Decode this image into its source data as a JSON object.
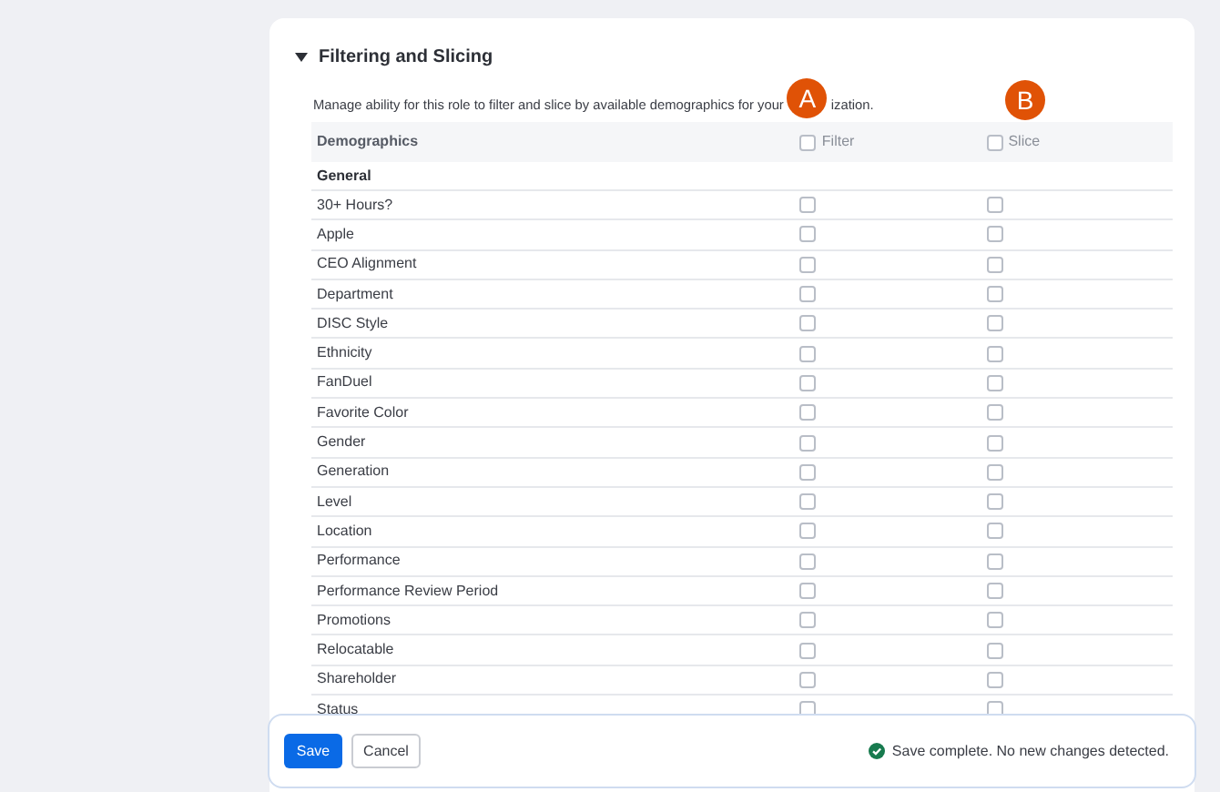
{
  "section": {
    "title": "Filtering and Slicing",
    "expanded": true,
    "description_start": "Manage ability for this role to filter and slice by available demographics for your",
    "description_end": "ization."
  },
  "badges": [
    {
      "label": "A",
      "color": "#e05206"
    },
    {
      "label": "B",
      "color": "#e05206"
    }
  ],
  "table": {
    "columns": [
      {
        "label": "Demographics"
      },
      {
        "label": "Filter",
        "checked": false
      },
      {
        "label": "Slice",
        "checked": false
      }
    ],
    "group": "General",
    "rows": [
      {
        "label": "30+ Hours?",
        "filter": false,
        "slice": false
      },
      {
        "label": "Apple",
        "filter": false,
        "slice": false
      },
      {
        "label": "CEO Alignment",
        "filter": false,
        "slice": false
      },
      {
        "label": "Department",
        "filter": false,
        "slice": false
      },
      {
        "label": "DISC Style",
        "filter": false,
        "slice": false
      },
      {
        "label": "Ethnicity",
        "filter": false,
        "slice": false
      },
      {
        "label": "FanDuel",
        "filter": false,
        "slice": false
      },
      {
        "label": "Favorite Color",
        "filter": false,
        "slice": false
      },
      {
        "label": "Gender",
        "filter": false,
        "slice": false
      },
      {
        "label": "Generation",
        "filter": false,
        "slice": false
      },
      {
        "label": "Level",
        "filter": false,
        "slice": false
      },
      {
        "label": "Location",
        "filter": false,
        "slice": false
      },
      {
        "label": "Performance",
        "filter": false,
        "slice": false
      },
      {
        "label": "Performance Review Period",
        "filter": false,
        "slice": false
      },
      {
        "label": "Promotions",
        "filter": false,
        "slice": false
      },
      {
        "label": "Relocatable",
        "filter": false,
        "slice": false
      },
      {
        "label": "Shareholder",
        "filter": false,
        "slice": false
      },
      {
        "label": "Status",
        "filter": false,
        "slice": false
      }
    ]
  },
  "footer": {
    "save": "Save",
    "cancel": "Cancel",
    "status": "Save complete. No new changes detected.",
    "status_ok": true
  }
}
